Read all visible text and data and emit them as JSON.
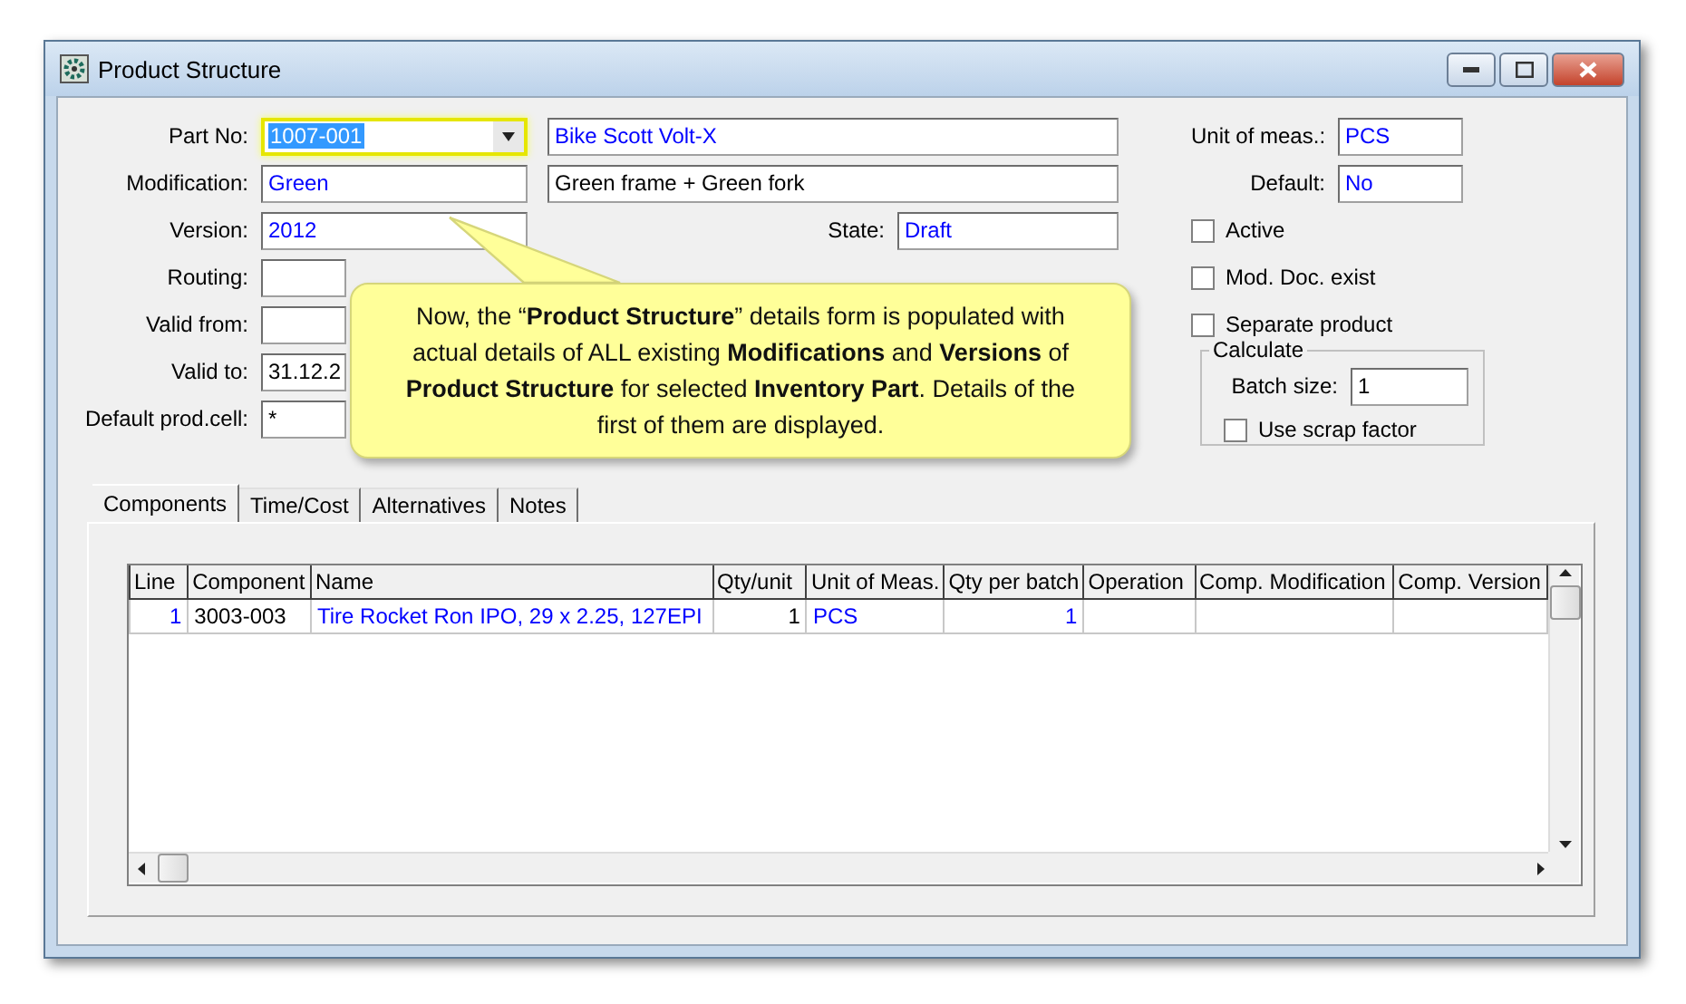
{
  "window": {
    "title": "Product Structure"
  },
  "form": {
    "part_no": {
      "label": "Part No:",
      "value": "1007-001",
      "selected": true,
      "description": "Bike Scott Volt-X"
    },
    "modification": {
      "label": "Modification:",
      "value": "Green",
      "description": "Green frame + Green fork"
    },
    "version": {
      "label": "Version:",
      "value": "2012"
    },
    "state": {
      "label": "State:",
      "value": "Draft"
    },
    "routing": {
      "label": "Routing:"
    },
    "valid_from": {
      "label": "Valid from:"
    },
    "valid_to": {
      "label": "Valid to:",
      "value": "31.12.2"
    },
    "default_prod_cell": {
      "label": "Default prod.cell:",
      "value": "*"
    },
    "unit_of_meas": {
      "label": "Unit of meas.:",
      "value": "PCS"
    },
    "default": {
      "label": "Default:",
      "value": "No"
    },
    "checkboxes": [
      {
        "label": "Active",
        "checked": false
      },
      {
        "label": "Mod. Doc. exist",
        "checked": false
      },
      {
        "label": "Separate product",
        "checked": false
      }
    ],
    "calculate": {
      "title": "Calculate",
      "batch_size": {
        "label": "Batch size:",
        "value": "1"
      },
      "use_scrap_factor": {
        "label": "Use scrap factor",
        "checked": false
      }
    }
  },
  "callout": {
    "text": "Now, the “**Product Structure**” details form is populated with actual details of ALL existing **Modifications** and **Versions** of **Product Structure** for selected **Inventory Part**.  Details of the first of them are displayed."
  },
  "tabs": [
    {
      "label": "Components",
      "selected": true
    },
    {
      "label": "Time/Cost",
      "selected": false
    },
    {
      "label": "Alternatives",
      "selected": false
    },
    {
      "label": "Notes",
      "selected": false
    }
  ],
  "table": {
    "columns": [
      {
        "label": "Line",
        "kind": "number",
        "linked": true
      },
      {
        "label": "Component",
        "kind": "text",
        "linked": false
      },
      {
        "label": "Name",
        "kind": "text",
        "linked": true
      },
      {
        "label": "Qty/unit",
        "kind": "number",
        "linked": false
      },
      {
        "label": "Unit of Meas.",
        "kind": "text",
        "linked": true
      },
      {
        "label": "Qty per batch",
        "kind": "number",
        "linked": true
      },
      {
        "label": "Operation",
        "kind": "text"
      },
      {
        "label": "Comp. Modification",
        "kind": "text"
      },
      {
        "label": "Comp. Version",
        "kind": "text"
      }
    ],
    "rows": [
      {
        "cells": [
          "1",
          "3003-003",
          "Tire Rocket Ron IPO, 29 x 2.25, 127EPI",
          "1",
          "PCS",
          "1",
          "",
          "",
          ""
        ]
      }
    ]
  }
}
